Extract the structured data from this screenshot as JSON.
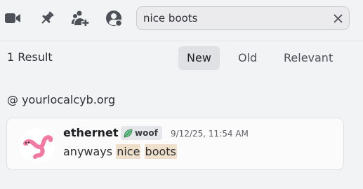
{
  "toolbar": {
    "icons": [
      {
        "name": "video-camera-icon"
      },
      {
        "name": "pin-icon"
      },
      {
        "name": "add-member-icon"
      },
      {
        "name": "user-profile-icon"
      }
    ]
  },
  "search": {
    "value": "nice boots",
    "placeholder": "Search"
  },
  "results": {
    "count_label": "1 Result",
    "sort_options": [
      "New",
      "Old",
      "Relevant"
    ],
    "active_sort": "New"
  },
  "channel": {
    "label": "@ yourlocalcyb.org"
  },
  "message": {
    "author": "ethernet",
    "tag": "woof",
    "timestamp": "9/12/25, 11:54 AM",
    "text_prefix": "anyways ",
    "highlight_1": "nice",
    "highlight_2": "boots"
  },
  "colors": {
    "highlight": "#efe0cc",
    "tag_leaf": "#3ba55c",
    "avatar_worm": "#f07aa2"
  }
}
